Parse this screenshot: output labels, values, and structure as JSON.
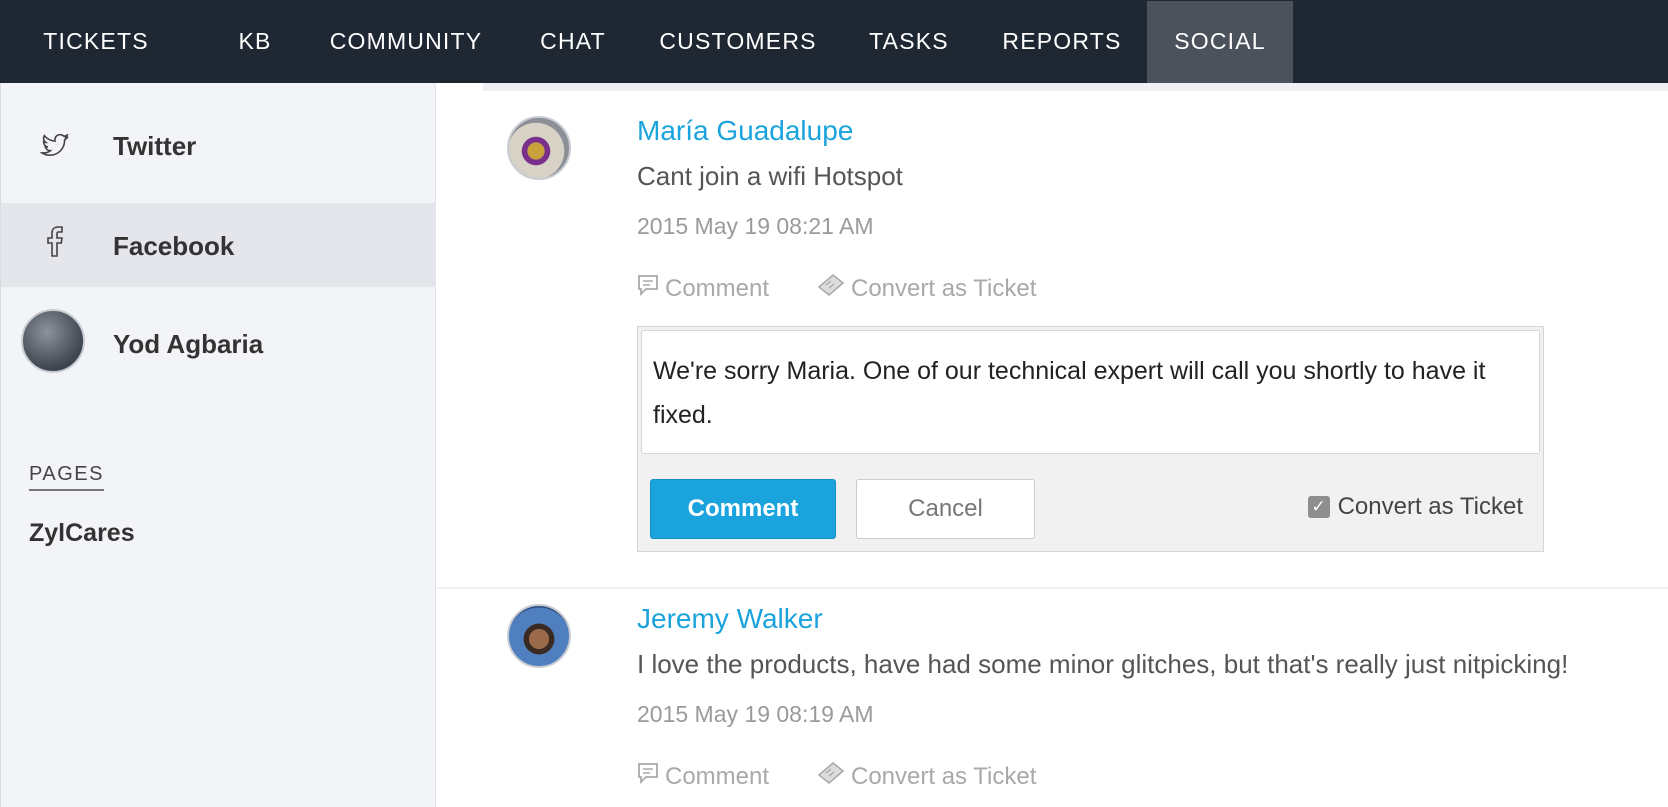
{
  "nav": {
    "items": [
      {
        "label": "TICKETS"
      },
      {
        "label": "KB"
      },
      {
        "label": "COMMUNITY"
      },
      {
        "label": "CHAT"
      },
      {
        "label": "CUSTOMERS"
      },
      {
        "label": "TASKS"
      },
      {
        "label": "REPORTS"
      },
      {
        "label": "SOCIAL",
        "active": true
      }
    ]
  },
  "sidebar": {
    "channels": [
      {
        "label": "Twitter",
        "icon": "twitter-icon"
      },
      {
        "label": "Facebook",
        "icon": "facebook-icon",
        "selected": true
      }
    ],
    "account": {
      "name": "Yod Agbaria"
    },
    "pages_heading": "PAGES",
    "pages": [
      {
        "label": "ZylCares"
      }
    ]
  },
  "posts": [
    {
      "author": "María Guadalupe",
      "text": "Cant join a wifi Hotspot",
      "time": "2015 May 19 08:21 AM",
      "actions": {
        "comment": "Comment",
        "convert": "Convert as Ticket"
      },
      "reply": {
        "value": "We're sorry Maria. One of our technical expert will call you shortly to have it fixed.",
        "submit_label": "Comment",
        "cancel_label": "Cancel",
        "convert_label": "Convert as Ticket",
        "convert_checked": true
      }
    },
    {
      "author": "Jeremy Walker",
      "text": "I love the products, have had some minor glitches, but that's really just nitpicking!",
      "time": "2015 May 19 08:19 AM",
      "actions": {
        "comment": "Comment",
        "convert": "Convert as Ticket"
      }
    }
  ],
  "colors": {
    "nav_bg": "#1f2732",
    "nav_active": "#4b525c",
    "accent": "#1aa3dc",
    "sidebar_bg": "#f3f4f8"
  }
}
